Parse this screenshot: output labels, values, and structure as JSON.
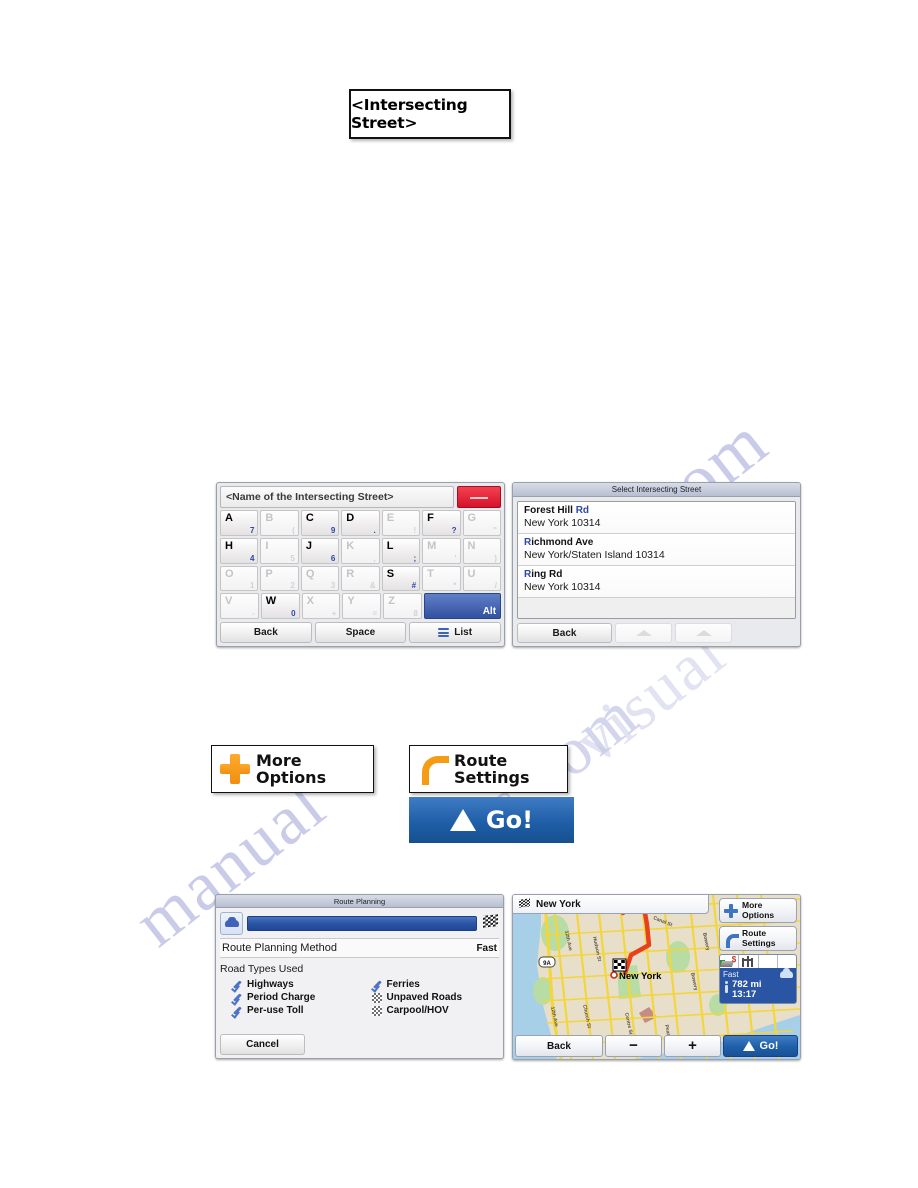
{
  "callout": {
    "text": "<Intersecting Street>"
  },
  "watermarks": [
    "com",
    "manual",
    "s.com",
    "visual"
  ],
  "keyboard_screen": {
    "input_value": "<Name of the Intersecting Street>",
    "delete_button": "delete-key",
    "rows": [
      [
        {
          "letter": "A",
          "sub": "7",
          "active": true
        },
        {
          "letter": "B",
          "sub": "(",
          "active": false
        },
        {
          "letter": "C",
          "sub": "9",
          "active": true
        },
        {
          "letter": "D",
          "sub": ".",
          "active": true
        },
        {
          "letter": "E",
          "sub": "!",
          "active": false
        },
        {
          "letter": "F",
          "sub": "?",
          "active": true
        },
        {
          "letter": "G",
          "sub": "\"",
          "active": false
        }
      ],
      [
        {
          "letter": "H",
          "sub": "4",
          "active": true
        },
        {
          "letter": "I",
          "sub": "5",
          "active": false
        },
        {
          "letter": "J",
          "sub": "6",
          "active": true
        },
        {
          "letter": "K",
          "sub": ",",
          "active": false
        },
        {
          "letter": "L",
          "sub": ";",
          "active": true
        },
        {
          "letter": "M",
          "sub": "'",
          "active": false
        },
        {
          "letter": "N",
          "sub": ")",
          "active": false
        }
      ],
      [
        {
          "letter": "O",
          "sub": "1",
          "active": false
        },
        {
          "letter": "P",
          "sub": "2",
          "active": false
        },
        {
          "letter": "Q",
          "sub": "3",
          "active": false
        },
        {
          "letter": "R",
          "sub": "&",
          "active": false
        },
        {
          "letter": "S",
          "sub": "#",
          "active": true
        },
        {
          "letter": "T",
          "sub": "*",
          "active": false
        },
        {
          "letter": "U",
          "sub": "/",
          "active": false
        }
      ],
      [
        {
          "letter": "V",
          "sub": "-",
          "active": false
        },
        {
          "letter": "W",
          "sub": "0",
          "active": true
        },
        {
          "letter": "X",
          "sub": "+",
          "active": false
        },
        {
          "letter": "Y",
          "sub": "=",
          "active": false
        },
        {
          "letter": "Z",
          "sub": "8",
          "active": false
        },
        {
          "letter": "Alt",
          "sub": "",
          "active": true,
          "alt": true
        }
      ]
    ],
    "alt_label": "Alt",
    "bottom": {
      "back": "Back",
      "space": "Space",
      "list": "List"
    }
  },
  "list_screen": {
    "title": "Select Intersecting Street",
    "results": [
      {
        "name_prefix": "Forest Hill ",
        "name_match": "Rd",
        "name_suffix": "",
        "city": "New York 10314"
      },
      {
        "name_prefix": "",
        "name_match": "R",
        "name_suffix": "ichmond Ave",
        "city": "New York/Staten Island 10314"
      },
      {
        "name_prefix": "",
        "name_match": "R",
        "name_suffix": "ing Rd",
        "city": "New York 10314"
      }
    ],
    "back": "Back",
    "up_arrow": "up-arrow",
    "down_arrow": "down-arrow"
  },
  "buttons": {
    "more_options_line1": "More",
    "more_options_line2": "Options",
    "route_settings_line1": "Route",
    "route_settings_line2": "Settings",
    "go": "Go!"
  },
  "route_planning": {
    "title": "Route Planning",
    "method_label": "Route Planning Method",
    "method_value": "Fast",
    "road_types_label": "Road Types Used",
    "left_column": [
      {
        "label": "Highways",
        "enabled": true
      },
      {
        "label": "Period Charge",
        "enabled": true
      },
      {
        "label": "Per-use Toll",
        "enabled": true
      }
    ],
    "right_column": [
      {
        "label": "Ferries",
        "enabled": true
      },
      {
        "label": "Unpaved Roads",
        "enabled": false
      },
      {
        "label": "Carpool/HOV",
        "enabled": false
      }
    ],
    "cancel": "Cancel"
  },
  "map_screen": {
    "header_title": "New York",
    "destination_label": "New York",
    "more_options_line1": "More",
    "more_options_line2": "Options",
    "route_settings_line1": "Route",
    "route_settings_line2": "Settings",
    "info": {
      "mode": "Fast",
      "distance": "782  mi",
      "time": "13:17"
    },
    "street_labels": [
      "12th Ave",
      "12th Ave",
      "Hudson St",
      "Church St",
      "Centre St",
      "Canal St",
      "Bowery",
      "Bowery",
      "Pearl St",
      "9A"
    ],
    "bottom": {
      "back": "Back",
      "zoom_out": "−",
      "zoom_in": "+",
      "go": "Go!"
    }
  },
  "colors": {
    "accent_blue": "#2a55a4",
    "orange": "#f59b14",
    "red_delete": "#d6122b",
    "match_blue": "#2b48a8",
    "route_red": "#e8401f"
  }
}
